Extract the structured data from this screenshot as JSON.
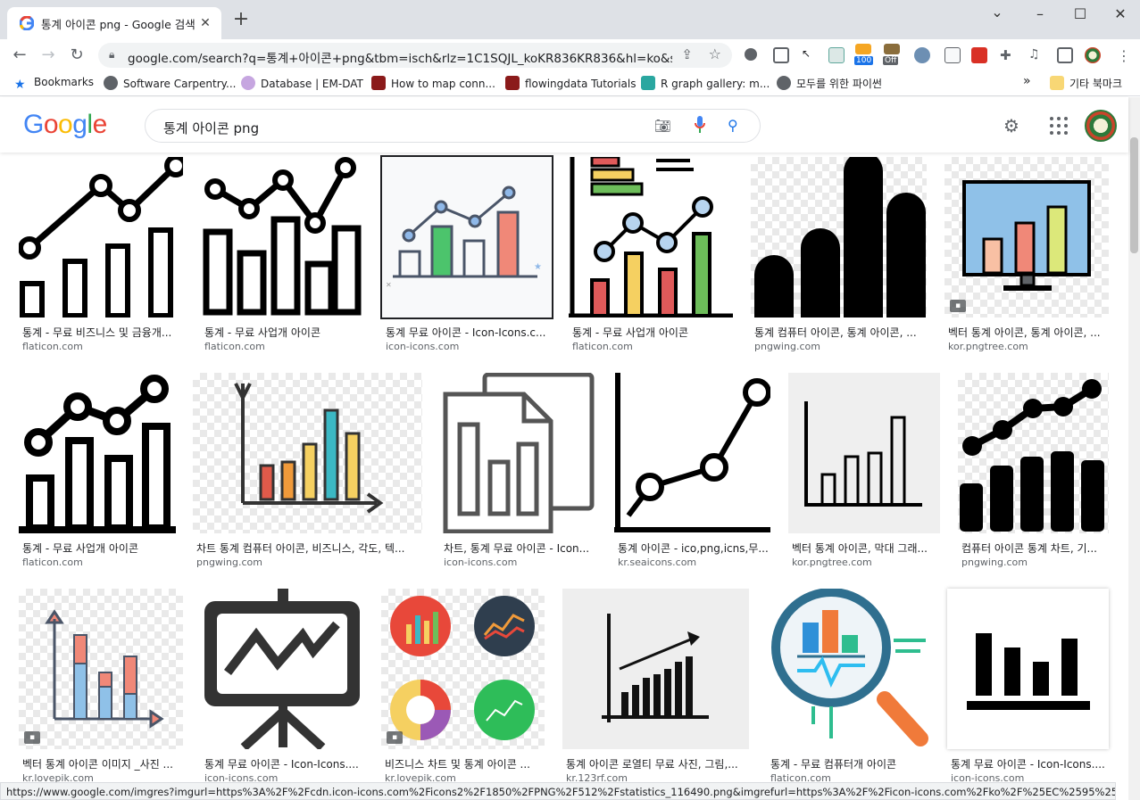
{
  "browser": {
    "tab_title": "통계 아이콘 png - Google 검색",
    "tab_close": "✕",
    "new_tab": "+",
    "url": "google.com/search?q=통계+아이콘+png&tbm=isch&rlz=1C1SQJL_koKR836KR836&hl=ko&sa...",
    "badge_100": "100",
    "badge_off": "Off",
    "win_min": "–",
    "win_max": "☐",
    "win_close": "✕"
  },
  "bookmarks": {
    "items": [
      {
        "label": "Bookmarks",
        "color": "#1a73e8"
      },
      {
        "label": "Software Carpentry...",
        "color": "#5f6368"
      },
      {
        "label": "Database | EM-DAT",
        "color": "#c6a6e0"
      },
      {
        "label": "How to map conn...",
        "color": "#8b1a1a"
      },
      {
        "label": "flowingdata Tutorials",
        "color": "#8b1a1a"
      },
      {
        "label": "R graph gallery: m...",
        "color": "#2aa7a0"
      },
      {
        "label": "모두를 위한 파이썬",
        "color": "#5f6368"
      }
    ],
    "more": "»",
    "other": "기타 북마크"
  },
  "google": {
    "logo": "Google",
    "query": "통계 아이콘 png"
  },
  "results": [
    {
      "title": "통계 - 무료 비즈니스 및 금융개...",
      "source": "flaticon.com"
    },
    {
      "title": "통계 - 무료 사업개 아이콘",
      "source": "flaticon.com"
    },
    {
      "title": "통계 무료 아이콘 - Icon-Icons.c...",
      "source": "icon-icons.com"
    },
    {
      "title": "통계 - 무료 사업개 아이콘",
      "source": "flaticon.com"
    },
    {
      "title": "통계 컴퓨터 아이콘, 통계 아이콘, ...",
      "source": "pngwing.com"
    },
    {
      "title": "벡터 통계 아이콘, 통계 아이콘, ...",
      "source": "kor.pngtree.com"
    },
    {
      "title": "통계 - 무료 사업개 아이콘",
      "source": "flaticon.com"
    },
    {
      "title": "차트 통계 컴퓨터 아이콘, 비즈니스, 각도, 텍...",
      "source": "pngwing.com"
    },
    {
      "title": "차트, 통계 무료 아이콘 - Icon...",
      "source": "icon-icons.com"
    },
    {
      "title": "통계 아이콘 - ico,png,icns,무...",
      "source": "kr.seaicons.com"
    },
    {
      "title": "벡터 통계 아이콘, 막대 그래...",
      "source": "kor.pngtree.com"
    },
    {
      "title": "컴퓨터 아이콘 통계 차트, 기...",
      "source": "pngwing.com"
    },
    {
      "title": "벡터 통계 아이콘 이미지 _사진 ...",
      "source": "kr.lovepik.com"
    },
    {
      "title": "통계 무료 아이콘 - Icon-Icons....",
      "source": "icon-icons.com"
    },
    {
      "title": "비즈니스 차트 및 통계 아이콘 ...",
      "source": "kr.lovepik.com"
    },
    {
      "title": "통계 아이콘 로열티 무료 사진, 그림,...",
      "source": "kr.123rf.com"
    },
    {
      "title": "통계 - 무료 컴퓨터개 아이콘",
      "source": "flaticon.com"
    },
    {
      "title": "통계 무료 아이콘 - Icon-Icons....",
      "source": "icon-icons.com"
    }
  ],
  "status_url": "https://www.google.com/imgres?imgurl=https%3A%2F%2Fcdn.icon-icons.com%2Ficons2%2F1850%2FPNG%2F512%2Fstatistics_116490.png&imgrefurl=https%3A%2F%2Ficon-icons.com%2Fko%2F%25EC%2595%2584%25EC%2..."
}
